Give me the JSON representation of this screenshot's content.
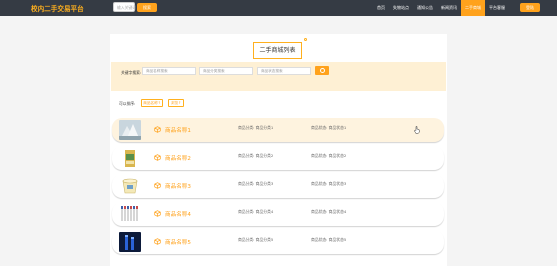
{
  "header": {
    "logo": "校内二手交易平台",
    "search_placeholder": "输入关键词",
    "search_button": "搜索",
    "nav": [
      "首页",
      "失物站点",
      "通知公告",
      "新闻资讯",
      "二手商城",
      "平台客服"
    ],
    "active_nav_index": 4,
    "login_button": "登陆"
  },
  "page": {
    "title": "二手商城列表"
  },
  "filter": {
    "keyword_label": "关键字搜索:",
    "inputs": [
      "商品名称搜索",
      "商品分类搜索",
      "商品状态搜索"
    ]
  },
  "sort": {
    "label": "可以排序:",
    "buttons": [
      "商品名称↑",
      "浏览↑"
    ]
  },
  "items": [
    {
      "name": "商品名称1",
      "category": "商品分类: 商品分类1",
      "status": "商品状态: 商品状态1"
    },
    {
      "name": "商品名称2",
      "category": "商品分类: 商品分类2",
      "status": "商品状态: 商品状态2"
    },
    {
      "name": "商品名称3",
      "category": "商品分类: 商品分类3",
      "status": "商品状态: 商品状态3"
    },
    {
      "name": "商品名称4",
      "category": "商品分类: 商品分类4",
      "status": "商品状态: 商品状态4"
    },
    {
      "name": "商品名称5",
      "category": "商品分类: 商品分类5",
      "status": "商品状态: 商品状态5"
    }
  ],
  "colors": {
    "accent": "#ffa21c",
    "topbar": "#353b44",
    "filter_bg": "#fef0d4"
  }
}
